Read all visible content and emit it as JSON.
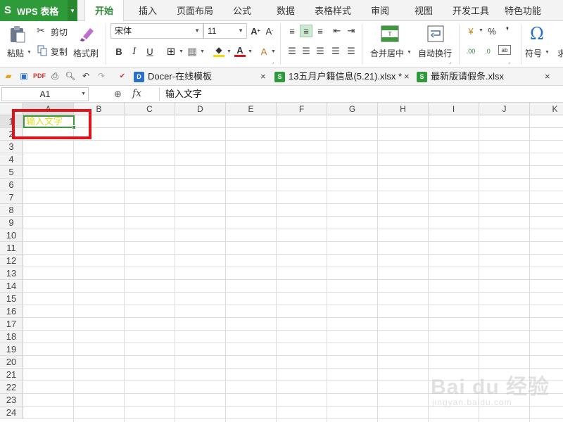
{
  "app": {
    "name": "WPS 表格"
  },
  "menu": {
    "items": [
      "开始",
      "插入",
      "页面布局",
      "公式",
      "数据",
      "表格样式",
      "审阅",
      "视图",
      "开发工具",
      "特色功能"
    ],
    "active": "开始"
  },
  "ribbon": {
    "paste_label": "粘贴",
    "cut_label": "剪切",
    "copy_label": "复制",
    "format_painter_label": "格式刷",
    "font_name": "宋体",
    "font_size": "11",
    "merge_label": "合并居中",
    "wrap_label": "自动换行",
    "symbol_label": "符号",
    "sum_partial": "求",
    "percent": "%",
    "comma": "❜",
    "dec_more": ".00",
    "dec_less": ".0"
  },
  "tabs": [
    {
      "label": "Docer-在线模板",
      "type": "docer"
    },
    {
      "label": "13五月户籍信息(5.21).xlsx *",
      "type": "xlsx"
    },
    {
      "label": "最新版请假条.xlsx",
      "type": "xlsx"
    }
  ],
  "formula_bar": {
    "name_box": "A1",
    "fx": "fx",
    "content": "输入文字"
  },
  "grid": {
    "columns": [
      "A",
      "B",
      "C",
      "D",
      "E",
      "F",
      "G",
      "H",
      "I",
      "J",
      "K"
    ],
    "rows": [
      "1",
      "2",
      "3",
      "4",
      "5",
      "6",
      "7",
      "8",
      "9",
      "10",
      "11",
      "12",
      "13",
      "14",
      "15",
      "16",
      "17",
      "18",
      "19",
      "20",
      "21",
      "22",
      "23",
      "24"
    ],
    "active_cell": "A1",
    "a1_value": "输入文字",
    "a1_text_color": "#d7df1d"
  },
  "colors": {
    "brand_green": "#2e9a3a",
    "highlight_red": "#e0121b",
    "selection_green": "#3c9a3c"
  },
  "watermark": {
    "main": "Bai du 经验",
    "sub": "jingyan.baidu.com"
  }
}
